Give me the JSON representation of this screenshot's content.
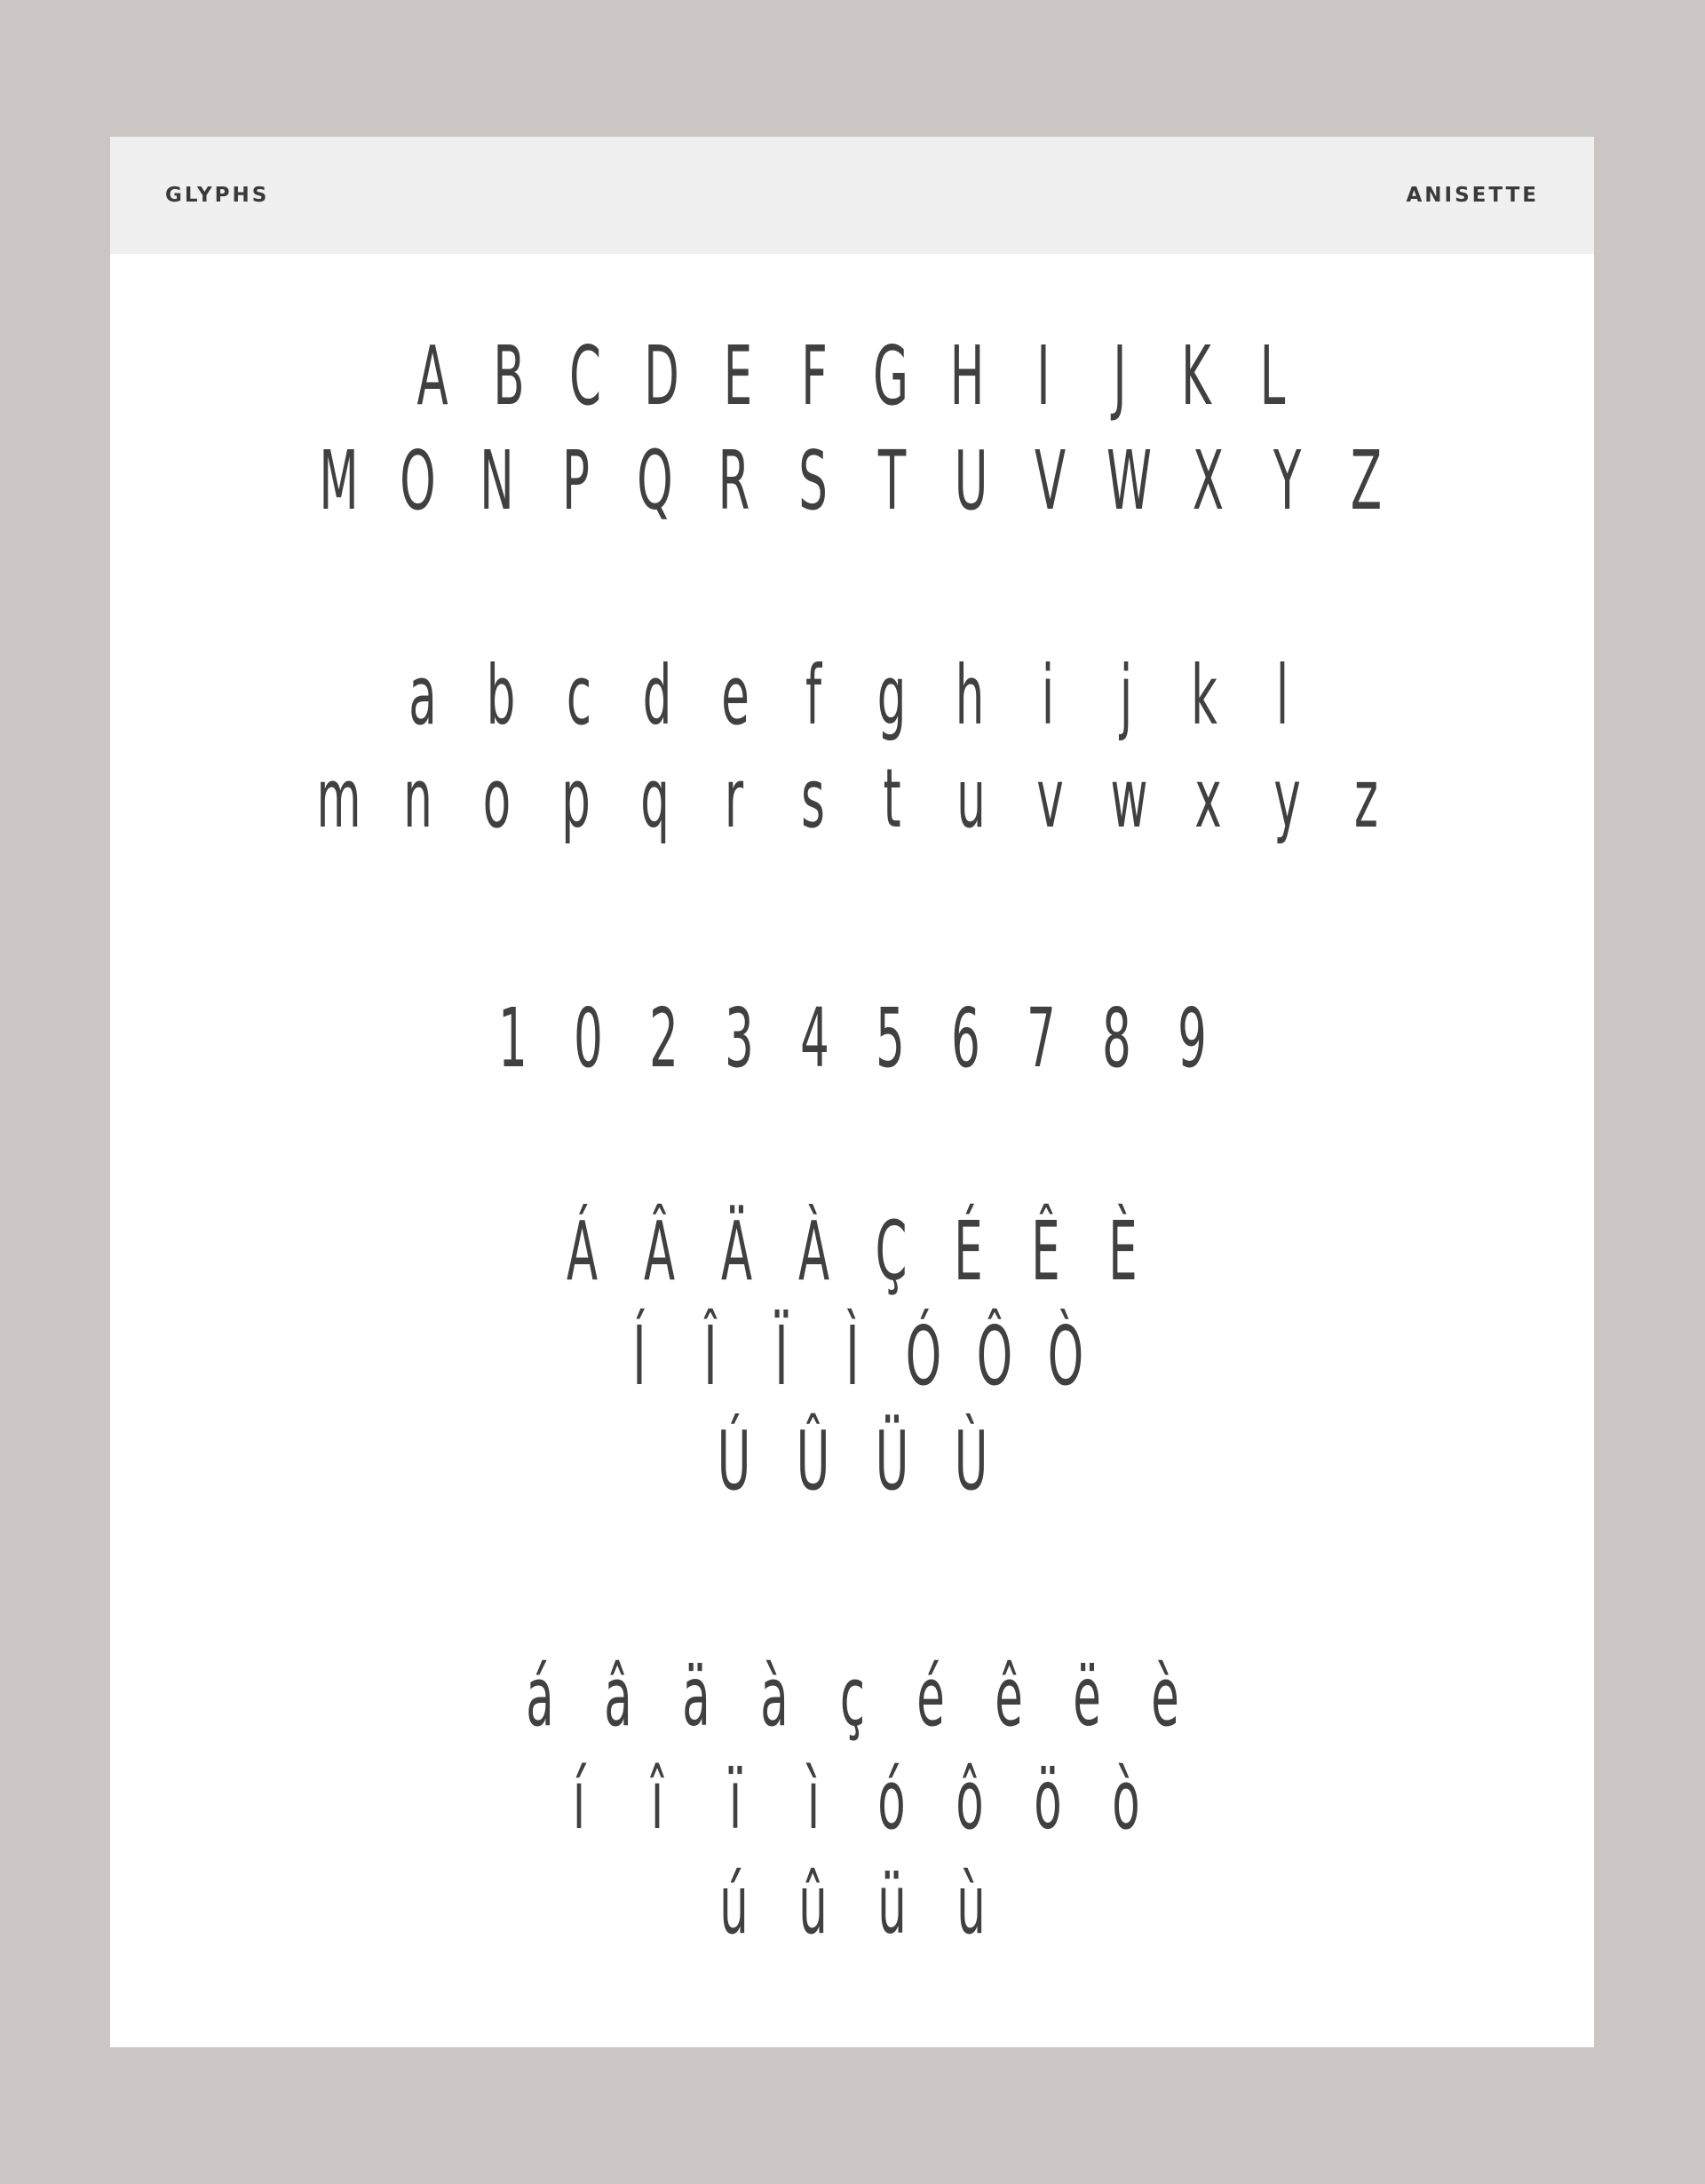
{
  "header": {
    "left_label": "GLYPHS",
    "right_label": "ANISETTE"
  },
  "glyph_rows": {
    "uppercase_1": [
      "A",
      "B",
      "C",
      "D",
      "E",
      "F",
      "G",
      "H",
      "I",
      "J",
      "K",
      "L"
    ],
    "uppercase_2": [
      "M",
      "O",
      "N",
      "P",
      "Q",
      "R",
      "S",
      "T",
      "U",
      "V",
      "W",
      "X",
      "Y",
      "Z"
    ],
    "lowercase_1": [
      "a",
      "b",
      "c",
      "d",
      "e",
      "f",
      "g",
      "h",
      "i",
      "j",
      "k",
      "l"
    ],
    "lowercase_2": [
      "m",
      "n",
      "o",
      "p",
      "q",
      "r",
      "s",
      "t",
      "u",
      "v",
      "w",
      "x",
      "y",
      "z"
    ],
    "digits": [
      "1",
      "0",
      "2",
      "3",
      "4",
      "5",
      "6",
      "7",
      "8",
      "9"
    ],
    "accent_upper_1": [
      "Á",
      "Â",
      "Ä",
      "À",
      "Ç",
      "É",
      "Ê",
      "È"
    ],
    "accent_upper_2": [
      "Í",
      "Î",
      "Ï",
      "Ì",
      "Ó",
      "Ô",
      "Ò"
    ],
    "accent_upper_3": [
      "Ú",
      "Û",
      "Ü",
      "Ù"
    ],
    "accent_lower_1": [
      "á",
      "â",
      "ä",
      "à",
      "ç",
      "é",
      "ê",
      "ë",
      "è"
    ],
    "accent_lower_2": [
      "í",
      "î",
      "ï",
      "ì",
      "ó",
      "ô",
      "ö",
      "ò"
    ],
    "accent_lower_3": [
      "ú",
      "û",
      "ü",
      "ù"
    ]
  }
}
